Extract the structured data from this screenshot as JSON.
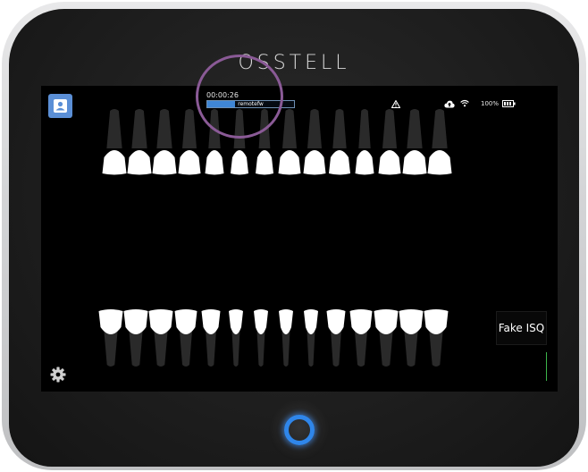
{
  "device": {
    "brand": "OSSTELL"
  },
  "status_bar": {
    "timer": "00:00:26",
    "progress_label": "remotefw",
    "progress_fraction": 0.32,
    "battery_text": "100%"
  },
  "icons": {
    "patient": "patient-icon",
    "warning": "warning-icon",
    "cloud": "cloud-upload-icon",
    "wifi": "wifi-icon",
    "battery": "battery-icon",
    "settings": "gear-icon"
  },
  "teeth": {
    "upper_count": 14,
    "lower_count": 14
  },
  "isq_button": {
    "label": "Fake ISQ"
  },
  "colors": {
    "accent_blue": "#3f86d6",
    "home_ring": "#2f86ea",
    "annotation": "#8a5a96",
    "indicator_green": "#3bb44a"
  }
}
